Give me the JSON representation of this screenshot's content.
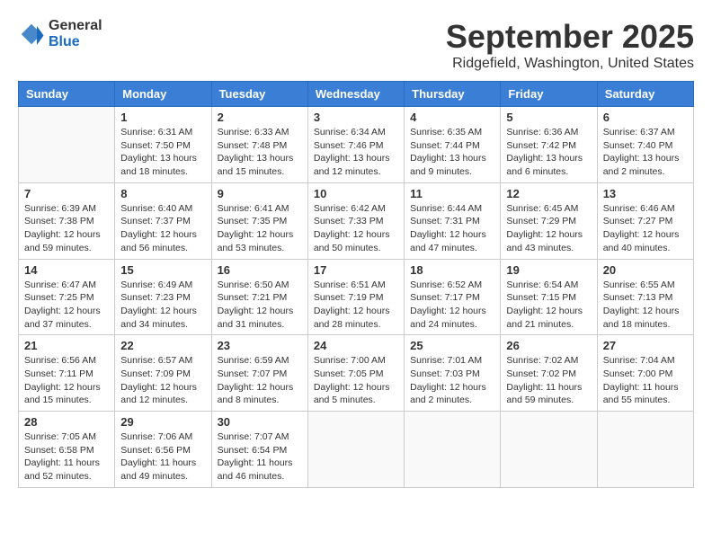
{
  "logo": {
    "general": "General",
    "blue": "Blue"
  },
  "title": {
    "month": "September 2025",
    "location": "Ridgefield, Washington, United States"
  },
  "weekdays": [
    "Sunday",
    "Monday",
    "Tuesday",
    "Wednesday",
    "Thursday",
    "Friday",
    "Saturday"
  ],
  "weeks": [
    [
      {
        "day": "",
        "sunrise": "",
        "sunset": "",
        "daylight": ""
      },
      {
        "day": "1",
        "sunrise": "Sunrise: 6:31 AM",
        "sunset": "Sunset: 7:50 PM",
        "daylight": "Daylight: 13 hours and 18 minutes."
      },
      {
        "day": "2",
        "sunrise": "Sunrise: 6:33 AM",
        "sunset": "Sunset: 7:48 PM",
        "daylight": "Daylight: 13 hours and 15 minutes."
      },
      {
        "day": "3",
        "sunrise": "Sunrise: 6:34 AM",
        "sunset": "Sunset: 7:46 PM",
        "daylight": "Daylight: 13 hours and 12 minutes."
      },
      {
        "day": "4",
        "sunrise": "Sunrise: 6:35 AM",
        "sunset": "Sunset: 7:44 PM",
        "daylight": "Daylight: 13 hours and 9 minutes."
      },
      {
        "day": "5",
        "sunrise": "Sunrise: 6:36 AM",
        "sunset": "Sunset: 7:42 PM",
        "daylight": "Daylight: 13 hours and 6 minutes."
      },
      {
        "day": "6",
        "sunrise": "Sunrise: 6:37 AM",
        "sunset": "Sunset: 7:40 PM",
        "daylight": "Daylight: 13 hours and 2 minutes."
      }
    ],
    [
      {
        "day": "7",
        "sunrise": "Sunrise: 6:39 AM",
        "sunset": "Sunset: 7:38 PM",
        "daylight": "Daylight: 12 hours and 59 minutes."
      },
      {
        "day": "8",
        "sunrise": "Sunrise: 6:40 AM",
        "sunset": "Sunset: 7:37 PM",
        "daylight": "Daylight: 12 hours and 56 minutes."
      },
      {
        "day": "9",
        "sunrise": "Sunrise: 6:41 AM",
        "sunset": "Sunset: 7:35 PM",
        "daylight": "Daylight: 12 hours and 53 minutes."
      },
      {
        "day": "10",
        "sunrise": "Sunrise: 6:42 AM",
        "sunset": "Sunset: 7:33 PM",
        "daylight": "Daylight: 12 hours and 50 minutes."
      },
      {
        "day": "11",
        "sunrise": "Sunrise: 6:44 AM",
        "sunset": "Sunset: 7:31 PM",
        "daylight": "Daylight: 12 hours and 47 minutes."
      },
      {
        "day": "12",
        "sunrise": "Sunrise: 6:45 AM",
        "sunset": "Sunset: 7:29 PM",
        "daylight": "Daylight: 12 hours and 43 minutes."
      },
      {
        "day": "13",
        "sunrise": "Sunrise: 6:46 AM",
        "sunset": "Sunset: 7:27 PM",
        "daylight": "Daylight: 12 hours and 40 minutes."
      }
    ],
    [
      {
        "day": "14",
        "sunrise": "Sunrise: 6:47 AM",
        "sunset": "Sunset: 7:25 PM",
        "daylight": "Daylight: 12 hours and 37 minutes."
      },
      {
        "day": "15",
        "sunrise": "Sunrise: 6:49 AM",
        "sunset": "Sunset: 7:23 PM",
        "daylight": "Daylight: 12 hours and 34 minutes."
      },
      {
        "day": "16",
        "sunrise": "Sunrise: 6:50 AM",
        "sunset": "Sunset: 7:21 PM",
        "daylight": "Daylight: 12 hours and 31 minutes."
      },
      {
        "day": "17",
        "sunrise": "Sunrise: 6:51 AM",
        "sunset": "Sunset: 7:19 PM",
        "daylight": "Daylight: 12 hours and 28 minutes."
      },
      {
        "day": "18",
        "sunrise": "Sunrise: 6:52 AM",
        "sunset": "Sunset: 7:17 PM",
        "daylight": "Daylight: 12 hours and 24 minutes."
      },
      {
        "day": "19",
        "sunrise": "Sunrise: 6:54 AM",
        "sunset": "Sunset: 7:15 PM",
        "daylight": "Daylight: 12 hours and 21 minutes."
      },
      {
        "day": "20",
        "sunrise": "Sunrise: 6:55 AM",
        "sunset": "Sunset: 7:13 PM",
        "daylight": "Daylight: 12 hours and 18 minutes."
      }
    ],
    [
      {
        "day": "21",
        "sunrise": "Sunrise: 6:56 AM",
        "sunset": "Sunset: 7:11 PM",
        "daylight": "Daylight: 12 hours and 15 minutes."
      },
      {
        "day": "22",
        "sunrise": "Sunrise: 6:57 AM",
        "sunset": "Sunset: 7:09 PM",
        "daylight": "Daylight: 12 hours and 12 minutes."
      },
      {
        "day": "23",
        "sunrise": "Sunrise: 6:59 AM",
        "sunset": "Sunset: 7:07 PM",
        "daylight": "Daylight: 12 hours and 8 minutes."
      },
      {
        "day": "24",
        "sunrise": "Sunrise: 7:00 AM",
        "sunset": "Sunset: 7:05 PM",
        "daylight": "Daylight: 12 hours and 5 minutes."
      },
      {
        "day": "25",
        "sunrise": "Sunrise: 7:01 AM",
        "sunset": "Sunset: 7:03 PM",
        "daylight": "Daylight: 12 hours and 2 minutes."
      },
      {
        "day": "26",
        "sunrise": "Sunrise: 7:02 AM",
        "sunset": "Sunset: 7:02 PM",
        "daylight": "Daylight: 11 hours and 59 minutes."
      },
      {
        "day": "27",
        "sunrise": "Sunrise: 7:04 AM",
        "sunset": "Sunset: 7:00 PM",
        "daylight": "Daylight: 11 hours and 55 minutes."
      }
    ],
    [
      {
        "day": "28",
        "sunrise": "Sunrise: 7:05 AM",
        "sunset": "Sunset: 6:58 PM",
        "daylight": "Daylight: 11 hours and 52 minutes."
      },
      {
        "day": "29",
        "sunrise": "Sunrise: 7:06 AM",
        "sunset": "Sunset: 6:56 PM",
        "daylight": "Daylight: 11 hours and 49 minutes."
      },
      {
        "day": "30",
        "sunrise": "Sunrise: 7:07 AM",
        "sunset": "Sunset: 6:54 PM",
        "daylight": "Daylight: 11 hours and 46 minutes."
      },
      {
        "day": "",
        "sunrise": "",
        "sunset": "",
        "daylight": ""
      },
      {
        "day": "",
        "sunrise": "",
        "sunset": "",
        "daylight": ""
      },
      {
        "day": "",
        "sunrise": "",
        "sunset": "",
        "daylight": ""
      },
      {
        "day": "",
        "sunrise": "",
        "sunset": "",
        "daylight": ""
      }
    ]
  ]
}
